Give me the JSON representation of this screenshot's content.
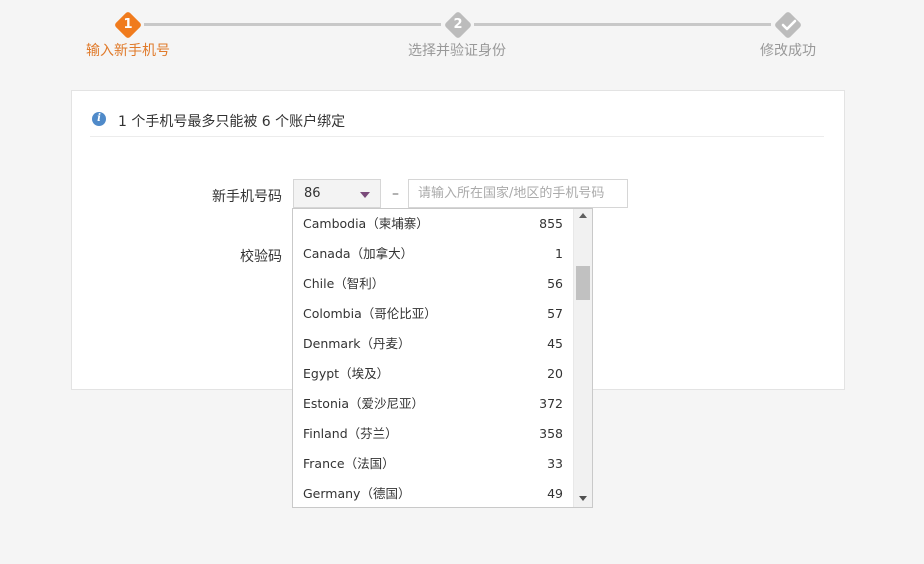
{
  "stepper": {
    "steps": [
      {
        "number": "1",
        "label": "输入新手机号",
        "state": "active"
      },
      {
        "number": "2",
        "label": "选择并验证身份",
        "state": "pending"
      },
      {
        "number": "",
        "icon": "check-icon",
        "label": "修改成功",
        "state": "pending"
      }
    ],
    "active_color": "#f07b1d",
    "inactive_color": "#bcbcbc"
  },
  "notice": {
    "icon": "info-icon",
    "text": "1 个手机号最多只能被 6 个账户绑定"
  },
  "form": {
    "phone_label": "新手机号码",
    "country_code": "86",
    "separator": "–",
    "phone_placeholder": "请输入所在国家/地区的手机号码",
    "code_label": "校验码"
  },
  "country_dropdown": {
    "options": [
      {
        "name": "Cambodia（柬埔寨）",
        "code": "855"
      },
      {
        "name": "Canada（加拿大）",
        "code": "1"
      },
      {
        "name": "Chile（智利）",
        "code": "56"
      },
      {
        "name": "Colombia（哥伦比亚）",
        "code": "57"
      },
      {
        "name": "Denmark（丹麦）",
        "code": "45"
      },
      {
        "name": "Egypt（埃及）",
        "code": "20"
      },
      {
        "name": "Estonia（爱沙尼亚）",
        "code": "372"
      },
      {
        "name": "Finland（芬兰）",
        "code": "358"
      },
      {
        "name": "France（法国）",
        "code": "33"
      },
      {
        "name": "Germany（德国）",
        "code": "49"
      }
    ]
  }
}
